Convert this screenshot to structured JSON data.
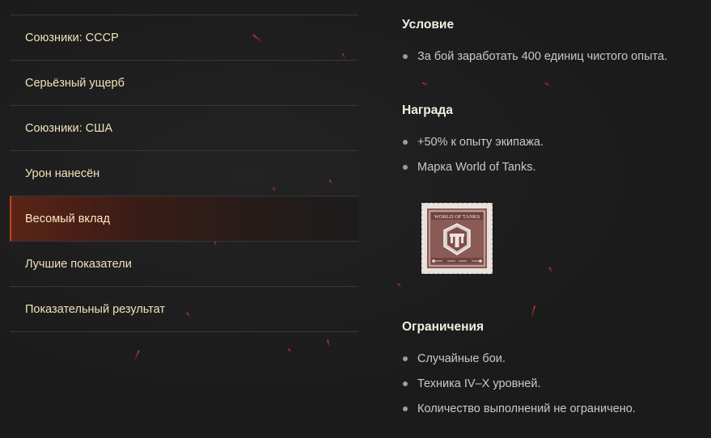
{
  "menu": {
    "items": [
      {
        "label": "Союзники: СССР",
        "active": false
      },
      {
        "label": "Серьёзный ущерб",
        "active": false
      },
      {
        "label": "Союзники: США",
        "active": false
      },
      {
        "label": "Урон нанесён",
        "active": false
      },
      {
        "label": "Весомый вклад",
        "active": true
      },
      {
        "label": "Лучшие показатели",
        "active": false
      },
      {
        "label": "Показательный результат",
        "active": false
      }
    ]
  },
  "details": {
    "condition": {
      "title": "Условие",
      "items": [
        "За бой заработать 400 единиц чистого опыта."
      ]
    },
    "reward": {
      "title": "Награда",
      "items": [
        "+50% к опыту экипажа.",
        "Марка World of Tanks."
      ],
      "stamp": {
        "caption": "WORLD OF TANKS",
        "icon": "world-of-tanks-stamp-icon"
      }
    },
    "restrictions": {
      "title": "Ограничения",
      "items": [
        "Случайные бои.",
        "Техника IV–X уровней.",
        "Количество выполнений не ограничено."
      ]
    }
  },
  "colors": {
    "background": "#1b1b1c",
    "menu_text": "#f0e2b8",
    "active_accent": "#c2411f",
    "spark": "#e0412a"
  }
}
